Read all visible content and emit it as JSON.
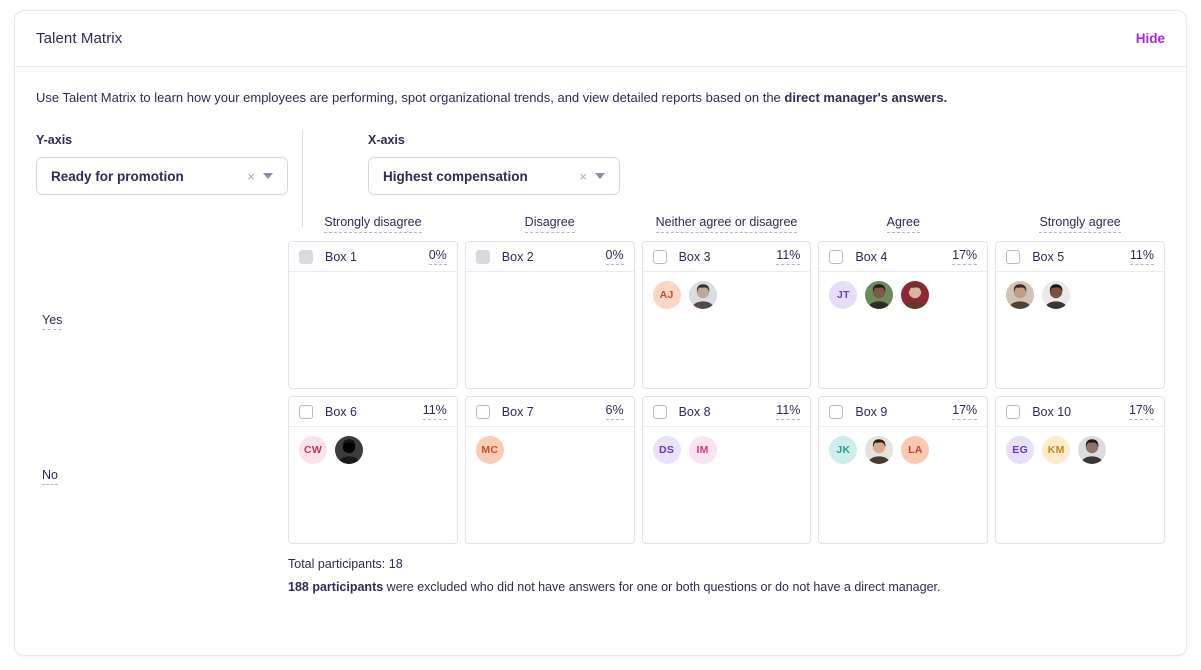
{
  "header": {
    "title": "Talent Matrix",
    "hide_label": "Hide"
  },
  "description": {
    "text": "Use Talent Matrix to learn how your employees are performing, spot organizational trends, and view detailed reports based on the ",
    "bold": "direct manager's answers."
  },
  "axes": {
    "y": {
      "label": "Y-axis",
      "value": "Ready for promotion",
      "clear_icon": "×",
      "caret_icon": "chevron-down-icon"
    },
    "x": {
      "label": "X-axis",
      "value": "Highest compensation",
      "clear_icon": "×",
      "caret_icon": "chevron-down-icon"
    }
  },
  "matrix": {
    "column_headers": [
      "Strongly disagree",
      "Disagree",
      "Neither agree or disagree",
      "Agree",
      "Strongly agree"
    ],
    "row_labels": [
      "Yes",
      "No"
    ],
    "boxes": [
      {
        "name": "Box 1",
        "percent": "0%",
        "checkbox_enabled": false,
        "people": []
      },
      {
        "name": "Box 2",
        "percent": "0%",
        "checkbox_enabled": false,
        "people": []
      },
      {
        "name": "Box 3",
        "percent": "11%",
        "checkbox_enabled": true,
        "people": [
          {
            "type": "initials",
            "initials": "AJ",
            "bg": "#fbd5c6",
            "fg": "#c2512c"
          },
          {
            "type": "photo",
            "tone": "#b9a99c",
            "hair": "#3d2f28",
            "bg": "#d9dde0"
          }
        ]
      },
      {
        "name": "Box 4",
        "percent": "17%",
        "checkbox_enabled": true,
        "people": [
          {
            "type": "initials",
            "initials": "JT",
            "bg": "#e6ddf7",
            "fg": "#6c3fc4"
          },
          {
            "type": "photo",
            "tone": "#7d5a46",
            "hair": "#241a15",
            "bg": "#6d8a5a"
          },
          {
            "type": "photo",
            "tone": "#d9b6a0",
            "hair": "#5d3b28",
            "bg": "#8c2733"
          }
        ]
      },
      {
        "name": "Box 5",
        "percent": "11%",
        "checkbox_enabled": true,
        "people": [
          {
            "type": "photo",
            "tone": "#c49b84",
            "hair": "#3a2a22",
            "bg": "#cfc2b6"
          },
          {
            "type": "photo",
            "tone": "#7a5340",
            "hair": "#1c1410",
            "bg": "#e9e9ec"
          }
        ]
      },
      {
        "name": "Box 6",
        "percent": "11%",
        "checkbox_enabled": true,
        "people": [
          {
            "type": "initials",
            "initials": "CW",
            "bg": "#fbe2ea",
            "fg": "#c2316b"
          },
          {
            "type": "photo",
            "tone": "#6b4staff",
            "hair": "#1a1210",
            "bg": "#3b3b40"
          }
        ]
      },
      {
        "name": "Box 7",
        "percent": "6%",
        "checkbox_enabled": true,
        "people": [
          {
            "type": "initials",
            "initials": "MC",
            "bg": "#fbcbb4",
            "fg": "#c0542a"
          }
        ]
      },
      {
        "name": "Box 8",
        "percent": "11%",
        "checkbox_enabled": true,
        "people": [
          {
            "type": "initials",
            "initials": "DS",
            "bg": "#e9e2f8",
            "fg": "#6b36c2"
          },
          {
            "type": "initials",
            "initials": "IM",
            "bg": "#fbe4ef",
            "fg": "#d4368c"
          }
        ]
      },
      {
        "name": "Box 9",
        "percent": "17%",
        "checkbox_enabled": true,
        "people": [
          {
            "type": "initials",
            "initials": "JK",
            "bg": "#cdeeea",
            "fg": "#2f9e92"
          },
          {
            "type": "photo",
            "tone": "#d6ab8e",
            "hair": "#2a1c14",
            "bg": "#e4e2df"
          },
          {
            "type": "initials",
            "initials": "LA",
            "bg": "#fbc9b1",
            "fg": "#c0462a"
          }
        ]
      },
      {
        "name": "Box 10",
        "percent": "17%",
        "checkbox_enabled": true,
        "people": [
          {
            "type": "initials",
            "initials": "EG",
            "bg": "#e7dff8",
            "fg": "#6b36c2"
          },
          {
            "type": "initials",
            "initials": "KM",
            "bg": "#fbeccb",
            "fg": "#b98a1f"
          },
          {
            "type": "photo",
            "tone": "#8a7568",
            "hair": "#201a16",
            "bg": "#dcdcdf"
          }
        ]
      }
    ],
    "footer": {
      "total": "Total participants: 18",
      "excluded_count": "188 participants",
      "excluded_rest": " were excluded who did not have answers for one or both questions or do not have a direct manager."
    }
  }
}
